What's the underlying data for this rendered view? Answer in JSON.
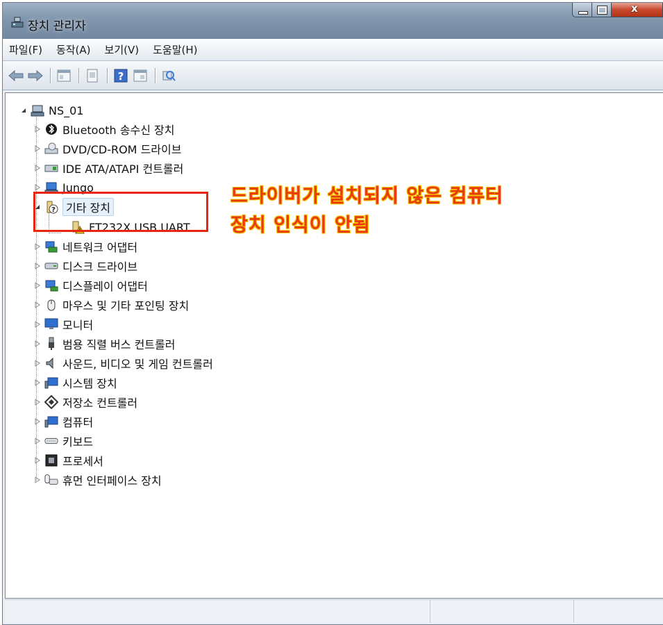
{
  "window": {
    "title": "장치 관리자"
  },
  "menu": [
    "파일(F)",
    "동작(A)",
    "보기(V)",
    "도움말(H)"
  ],
  "toolbar": [
    "back-icon",
    "forward-icon",
    "properties-icon",
    "update-icon",
    "help-icon",
    "show-hidden-icon",
    "scan-icon"
  ],
  "tree": {
    "root": "NS_01",
    "categories": [
      "Bluetooth 송수신 장치",
      "DVD/CD-ROM 드라이브",
      "IDE ATA/ATAPI 컨트롤러",
      "Jungo",
      "기타 장치",
      "네트워크 어댑터",
      "디스크 드라이브",
      "디스플레이 어댑터",
      "마우스 및 기타 포인팅 장치",
      "모니터",
      "범용 직렬 버스 컨트롤러",
      "사운드, 비디오 및 게임 컨트롤러",
      "시스템 장치",
      "저장소 컨트롤러",
      "컴퓨터",
      "키보드",
      "프로세서",
      "휴먼 인터페이스 장치"
    ],
    "other_device_child": "FT232X USB UART"
  },
  "annotation": {
    "line1": "드라이버가 설치되지 않은 컴퓨터",
    "line2": "장치 인식이 안됨"
  },
  "colors": {
    "annotation": "#e83a0c",
    "highlight_box": "#e8260d"
  }
}
